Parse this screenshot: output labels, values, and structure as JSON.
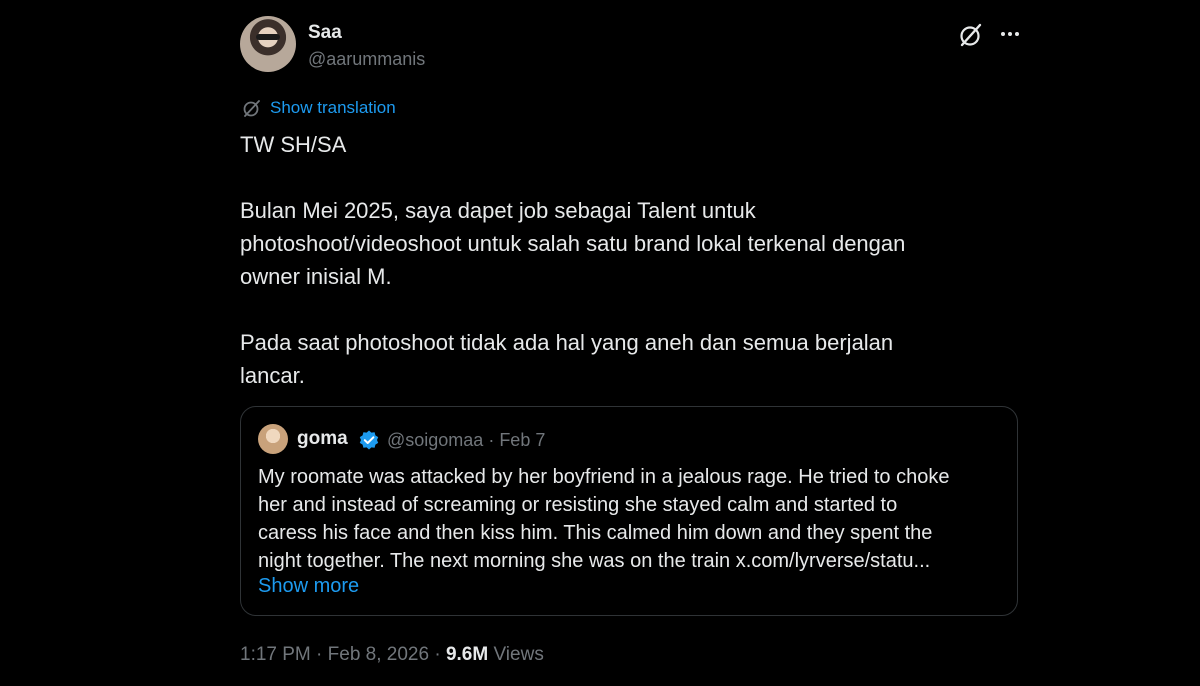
{
  "author": {
    "display_name": "Saa",
    "handle": "@aarummanis"
  },
  "translation_label": "Show translation",
  "body": {
    "line1": "TW SH/SA",
    "para2_line1": "Bulan Mei 2025, saya dapet job sebagai Talent untuk",
    "para2_line2": "photoshoot/videoshoot untuk salah satu brand lokal terkenal dengan",
    "para2_line3": "owner inisial M.",
    "para3_line1": "Pada saat photoshoot tidak ada hal yang aneh dan semua berjalan",
    "para3_line2": "lancar."
  },
  "quote": {
    "display_name": "goma",
    "meta": "@soigomaa · Feb 7",
    "lines": [
      "My roomate was attacked by her boyfriend in a jealous rage. He tried to choke",
      "her and instead of screaming or resisting she stayed calm and started to",
      "caress his face and then kiss him. This calmed him down and they spent the",
      "night together. The next morning she was on the train x.com/lyrverse/statu..."
    ],
    "show_more": "Show more"
  },
  "footer": {
    "time_date": "1:17 PM · Feb 8, 2026 · ",
    "views_count": "9.6M",
    "views_label": " Views"
  },
  "colors": {
    "background": "#000000",
    "text": "#e7e9ea",
    "secondary": "#71767b",
    "link": "#1d9bf0",
    "border": "#2f3336"
  },
  "icons": [
    "grok-icon",
    "more-icon",
    "translate-icon",
    "verified-badge-icon"
  ]
}
